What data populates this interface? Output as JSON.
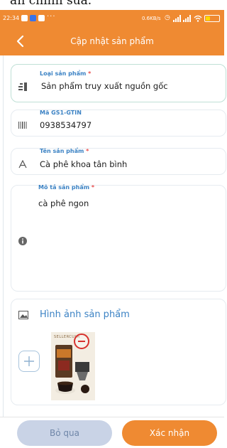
{
  "top_caption": "ần chỉnh sửa.",
  "status_bar": {
    "time": "22:34",
    "network_speed": "0.6KB/s",
    "battery_level": 0.35,
    "battery_color": "#ffd800"
  },
  "header": {
    "title": "Cập nhật sản phẩm",
    "back_icon": "chevron-left-icon",
    "color": "#ef8a32"
  },
  "form": {
    "product_type": {
      "label": "Loại sản phẩm",
      "required": "*",
      "value": "Sản phẩm truy xuất nguồn gốc",
      "icon": "category-icon"
    },
    "gtin": {
      "label": "Mã GS1-GTIN",
      "value": "0938534797",
      "icon": "barcode-icon"
    },
    "name": {
      "label": "Tên sản phẩm",
      "required": "*",
      "value": "Cà phê khoa tân bình",
      "icon": "text-icon"
    },
    "description": {
      "label": "Mô tả sản phẩm",
      "required": "*",
      "value": "cà phê ngon",
      "icon": "info-icon"
    },
    "images": {
      "title": "Hình ảnh sản phẩm",
      "icon": "image-icon",
      "add_icon": "plus-icon",
      "remove_icon": "remove-circle-icon",
      "thumbnail_brand": "SELLERCULA"
    }
  },
  "footer": {
    "skip_label": "Bỏ qua",
    "confirm_label": "Xác nhận"
  }
}
